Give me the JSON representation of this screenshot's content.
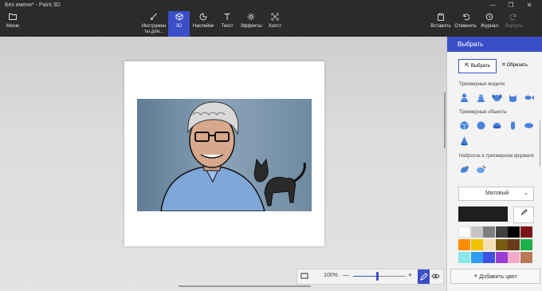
{
  "window": {
    "title": "Без имени* - Paint 3D",
    "minimize": "—",
    "maximize": "❐",
    "close": "✕"
  },
  "toolbar": {
    "menu": {
      "label": "Меню",
      "icon": "folder-icon"
    },
    "tools": [
      {
        "label": "Инструмен\nты для...",
        "icon": "brush-icon",
        "active": false
      },
      {
        "label": "3D",
        "icon": "cube-icon",
        "active": true
      },
      {
        "label": "Наклейки",
        "icon": "sticker-icon",
        "active": false
      },
      {
        "label": "Текст",
        "icon": "text-icon",
        "active": false
      },
      {
        "label": "Эффекты",
        "icon": "effects-icon",
        "active": false
      },
      {
        "label": "Холст",
        "icon": "canvas-icon",
        "active": false
      }
    ],
    "right": [
      {
        "label": "Вставить",
        "icon": "paste-icon",
        "disabled": false
      },
      {
        "label": "Отменить",
        "icon": "undo-icon",
        "disabled": false
      },
      {
        "label": "Журнал",
        "icon": "history-icon",
        "disabled": false
      },
      {
        "label": "Вернуть",
        "icon": "redo-icon",
        "disabled": true
      }
    ]
  },
  "zoom": {
    "value": "100%",
    "minus": "—",
    "plus": "+"
  },
  "panel": {
    "title": "Выбрать",
    "select_label": "Выбрать",
    "crop_label": "Обрезать",
    "models_title": "Трехмерные модели",
    "objects_title": "Трехмерные объекты",
    "doodle_title": "Набросок в трехмерном формате",
    "material": "Матовый",
    "add_color": "Добавить цвет",
    "accent": "#3a4fc7",
    "current_color": "#1e1e1e",
    "palette": [
      "#ffffff",
      "#c4c4c4",
      "#7f7f7f",
      "#3f3f3f",
      "#000000",
      "#7a1416",
      "#ff8c00",
      "#f2c200",
      "#f5deb3",
      "#7a5a10",
      "#6b3a1a",
      "#1cb24b",
      "#8ae7ea",
      "#2e9cf0",
      "#3f4fe0",
      "#9c3cd3",
      "#f4a8c9",
      "#b97a57"
    ]
  }
}
